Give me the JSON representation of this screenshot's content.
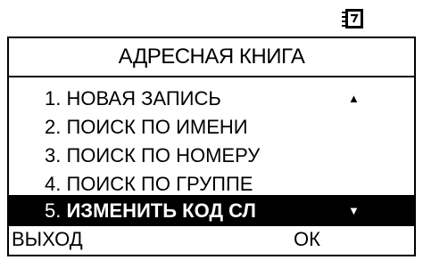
{
  "status_bar": {
    "icon": "address-book-icon"
  },
  "title": "АДРЕСНАЯ КНИГА",
  "menu": {
    "items": [
      {
        "number": "1.",
        "label": "НОВАЯ ЗАПИСЬ"
      },
      {
        "number": "2.",
        "label": "ПОИСК ПО ИМЕНИ"
      },
      {
        "number": "3.",
        "label": "ПОИСК ПО НОМЕРУ"
      },
      {
        "number": "4.",
        "label": "ПОИСК ПО ГРУППЕ"
      },
      {
        "number": "5.",
        "label": "ИЗМЕНИТЬ КОД СЛ"
      }
    ],
    "selected_index": 4,
    "scroll_up": "▲",
    "scroll_down": "▼"
  },
  "softkeys": {
    "left": "ВЫХОД",
    "center": "ОК"
  },
  "colors": {
    "background": "#ffffff",
    "foreground": "#000000",
    "highlight": "#000000",
    "highlight_text": "#ffffff"
  }
}
